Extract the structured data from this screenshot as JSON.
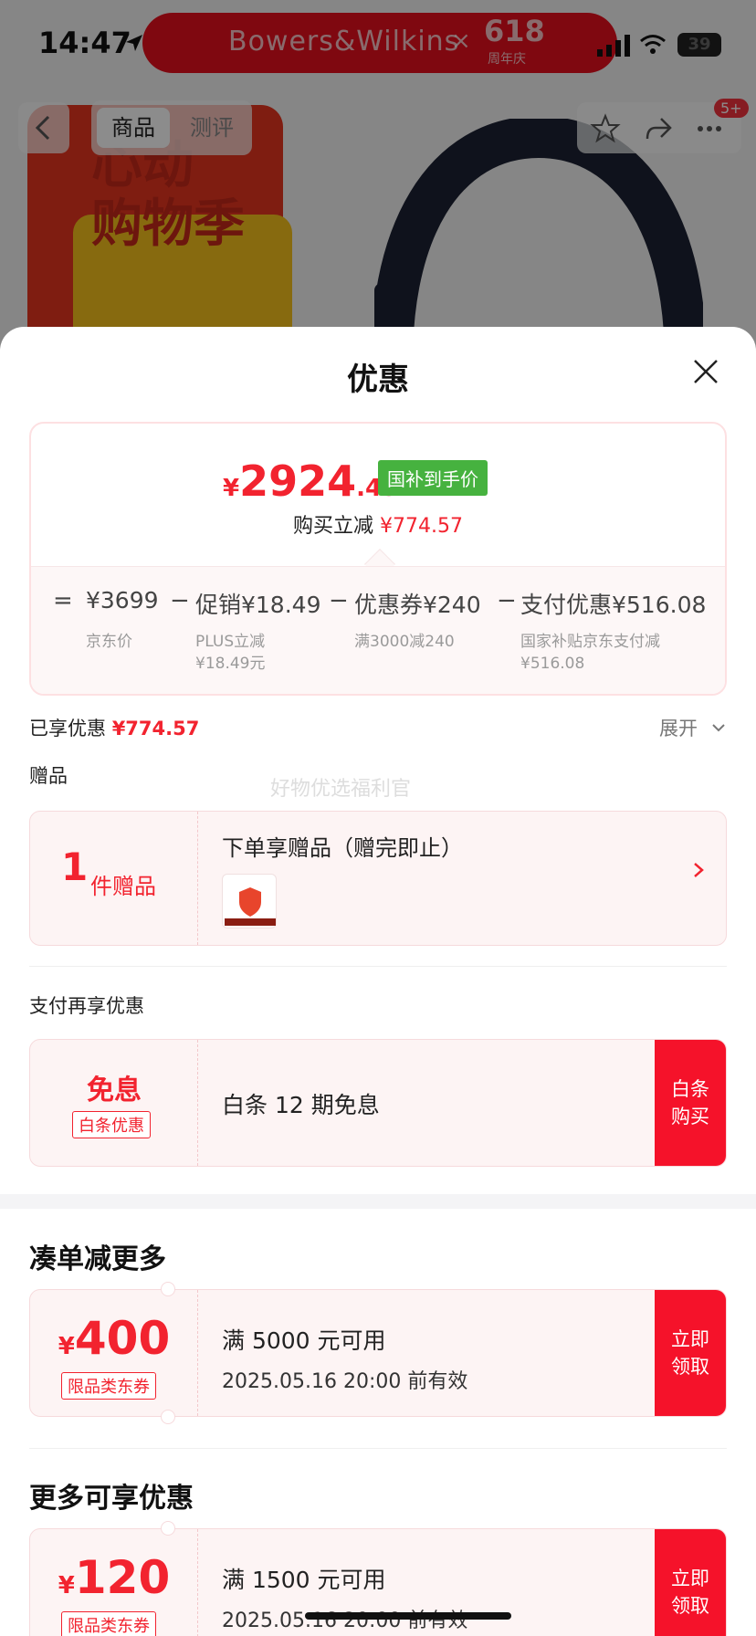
{
  "status_bar": {
    "time": "14:47",
    "battery": "39"
  },
  "banner": {
    "brand": "Bowers&Wilkins",
    "times": "×",
    "event_number": "618",
    "event_sub": "周年庆"
  },
  "nav": {
    "tabs": [
      {
        "label": "商品"
      },
      {
        "label": "测评"
      }
    ],
    "badge": "5+"
  },
  "poster": {
    "text_1": "心动",
    "text_2": "购物季"
  },
  "sheet": {
    "title": "优惠",
    "price": {
      "yen": "¥",
      "integer": "2924",
      "decimal": ".43",
      "tag": "国补到手价",
      "reduce_label": "购买立减",
      "reduce_value": "¥774.57"
    },
    "breakdown": [
      {
        "op": "=",
        "value": "¥3699",
        "sub": [
          "京东价"
        ]
      },
      {
        "op": "−",
        "value": "促销¥18.49",
        "sub": [
          "PLUS立减",
          "¥18.49元"
        ]
      },
      {
        "op": "−",
        "value": "优惠券¥240",
        "sub": [
          "满3000减240"
        ]
      },
      {
        "op": "−",
        "value": "支付优惠¥516.08",
        "sub": [
          "国家补贴京东支付减",
          "¥516.08"
        ]
      }
    ],
    "enjoyed_label": "已享优惠",
    "enjoyed_value": "¥774.57",
    "expand_label": "展开",
    "gift_section_label": "赠品",
    "watermark": "好物优选福利官",
    "gift": {
      "count": "1",
      "unit": "件赠品",
      "title": "下单享赠品（赠完即止）"
    },
    "pay_section_label": "支付再享优惠",
    "baitiao": {
      "big": "免息",
      "tag": "白条优惠",
      "text": "白条 12 期免息",
      "button_line1": "白条",
      "button_line2": "购买"
    },
    "combine_heading": "凑单减更多",
    "coupon_400": {
      "yen": "¥",
      "amount": "400",
      "tag": "限品类东券",
      "condition": "满 5000 元可用",
      "valid": "2025.05.16 20:00 前有效",
      "button_line1": "立即",
      "button_line2": "领取"
    },
    "more_heading": "更多可享优惠",
    "coupon_120": {
      "yen": "¥",
      "amount": "120",
      "tag": "限品类东券",
      "condition": "满 1500 元可用",
      "valid": "2025.05.16 20:00 前有效",
      "button_line1": "立即",
      "button_line2": "领取"
    }
  },
  "colors": {
    "accent_red": "#f2232f",
    "button_red": "#f5122a",
    "gov_green": "#46b23f"
  },
  "icons": [
    "location-arrow-icon",
    "signal-icon",
    "wifi-icon",
    "back-icon",
    "star-icon",
    "share-icon",
    "more-icon",
    "close-icon",
    "chevron-down-icon",
    "chevron-right-icon"
  ]
}
